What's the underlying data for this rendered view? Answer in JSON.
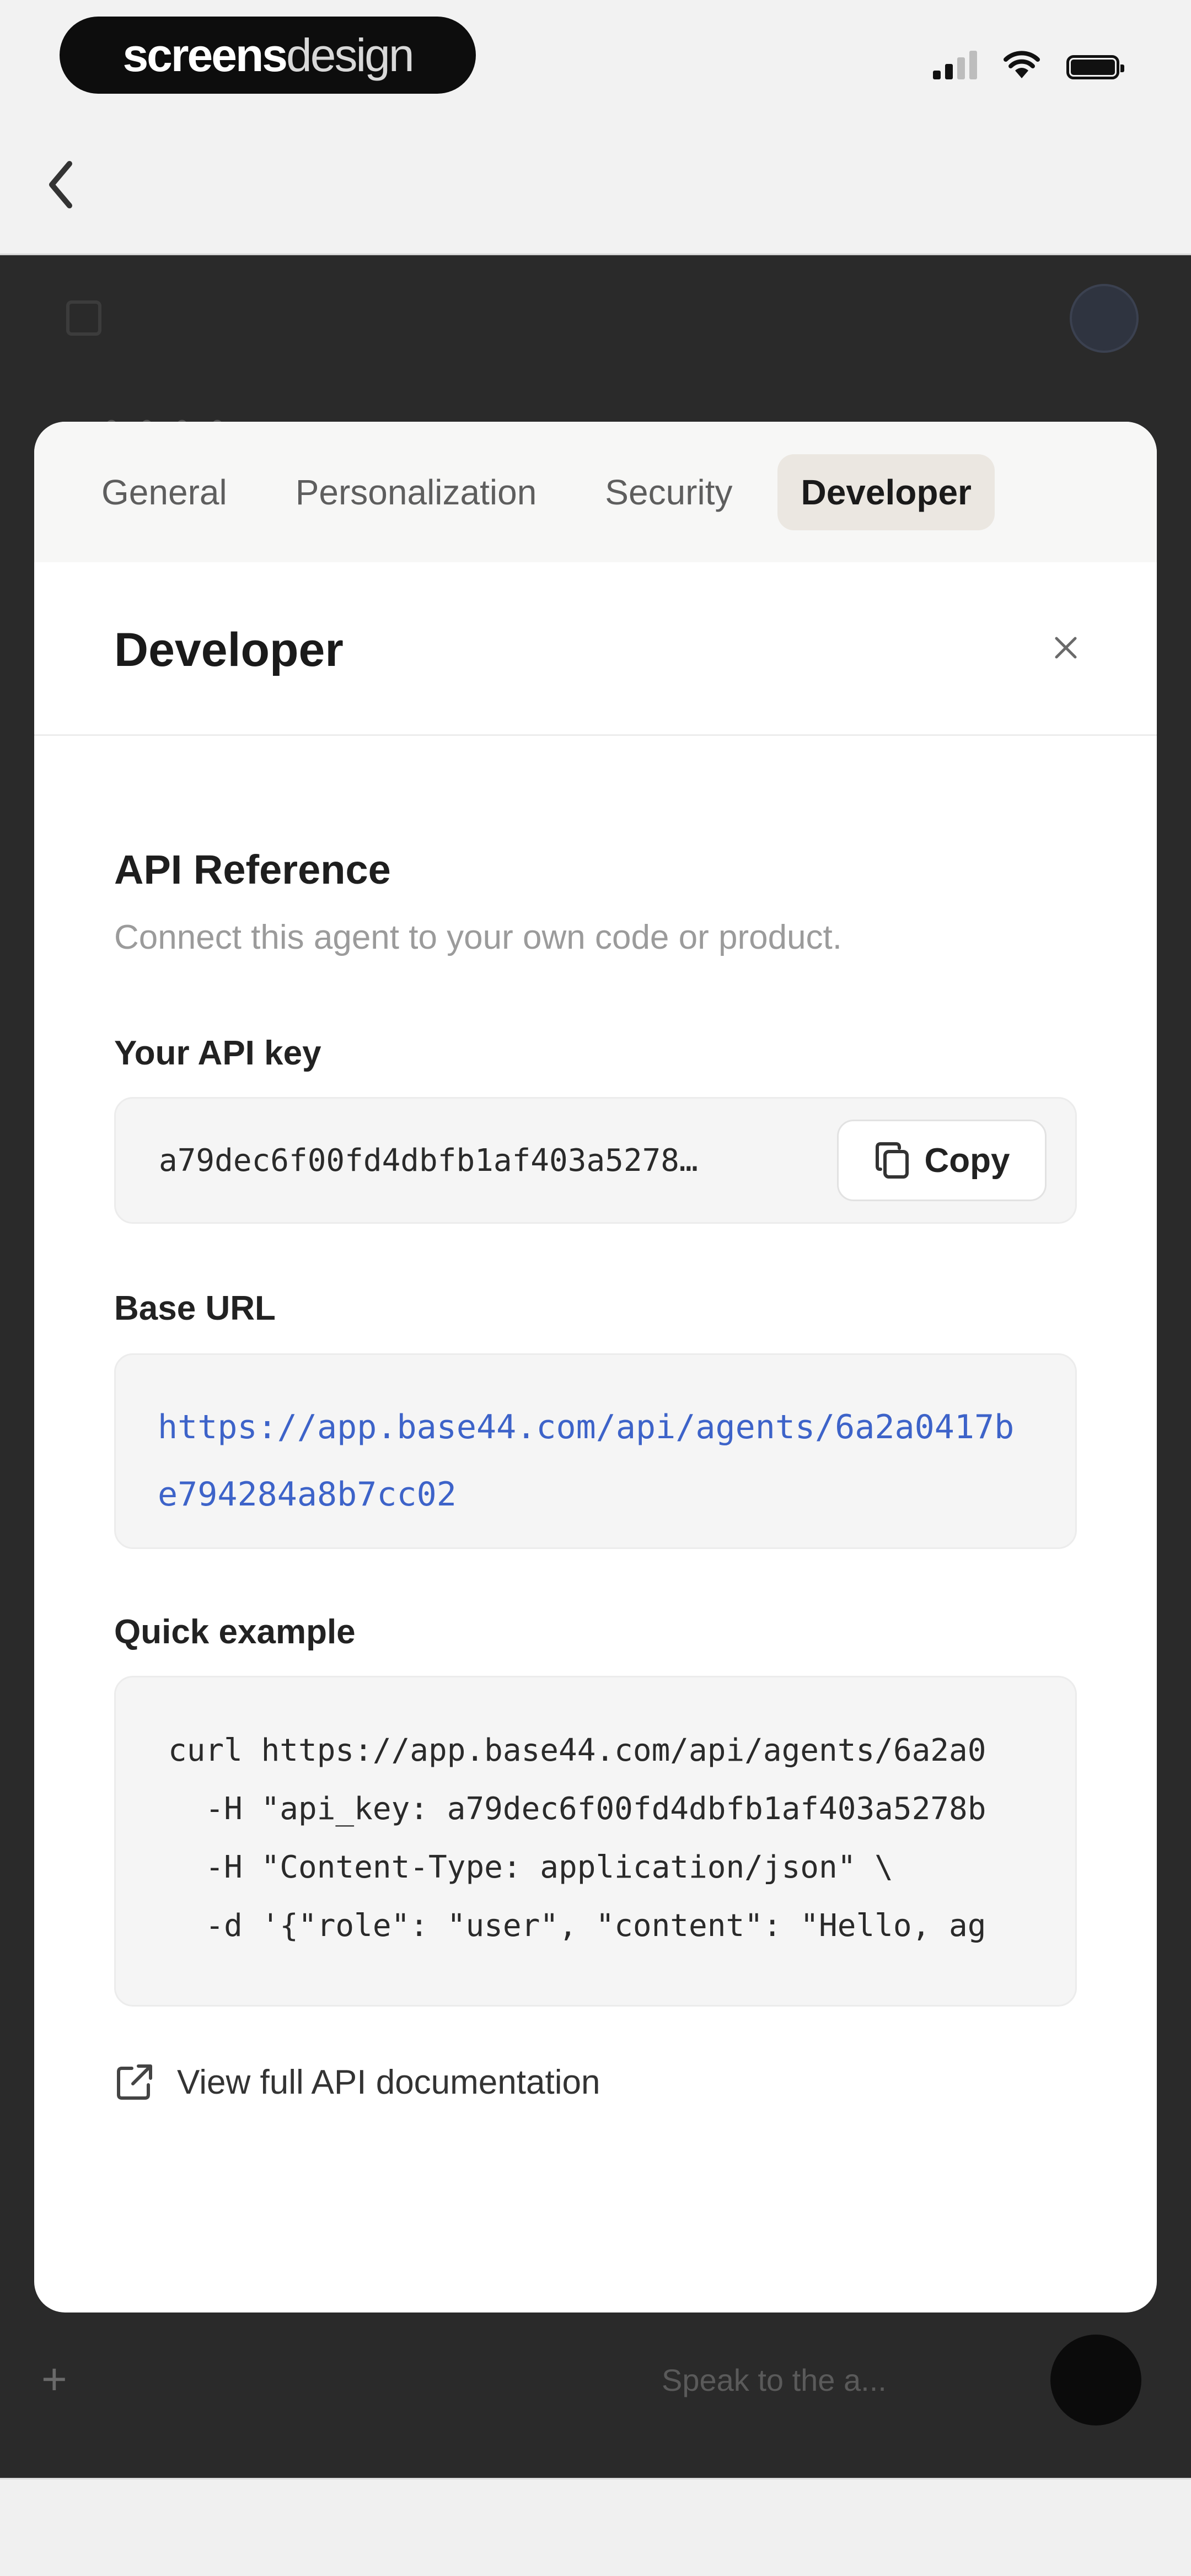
{
  "status_bar": {
    "brand_bold": "screens",
    "brand_light": "design"
  },
  "dimmed_app": {
    "input_placeholder": "Speak to the a..."
  },
  "modal": {
    "tabs": [
      {
        "label": "General",
        "active": false
      },
      {
        "label": "Personalization",
        "active": false
      },
      {
        "label": "Security",
        "active": false
      },
      {
        "label": "Developer",
        "active": true
      }
    ],
    "title": "Developer",
    "api_reference": {
      "heading": "API Reference",
      "subtitle": "Connect this agent to your own code or product."
    },
    "api_key": {
      "label": "Your API key",
      "value": "a79dec6f00fd4dbfb1af403a5278…",
      "copy_label": "Copy"
    },
    "base_url": {
      "label": "Base URL",
      "value": "https://app.base44.com/api/agents/6a2a0417be794284a8b7cc02"
    },
    "quick_example": {
      "label": "Quick example",
      "lines": [
        "curl https://app.base44.com/api/agents/6a2a0",
        "  -H \"api_key: a79dec6f00fd4dbfb1af403a5278b",
        "  -H \"Content-Type: application/json\" \\",
        "  -d '{\"role\": \"user\", \"content\": \"Hello, ag"
      ]
    },
    "docs_link": "View full API documentation"
  },
  "colors": {
    "link_blue": "#3d63c9",
    "active_tab_bg": "#ebe7e1",
    "overlay": "#2b2b2b"
  }
}
